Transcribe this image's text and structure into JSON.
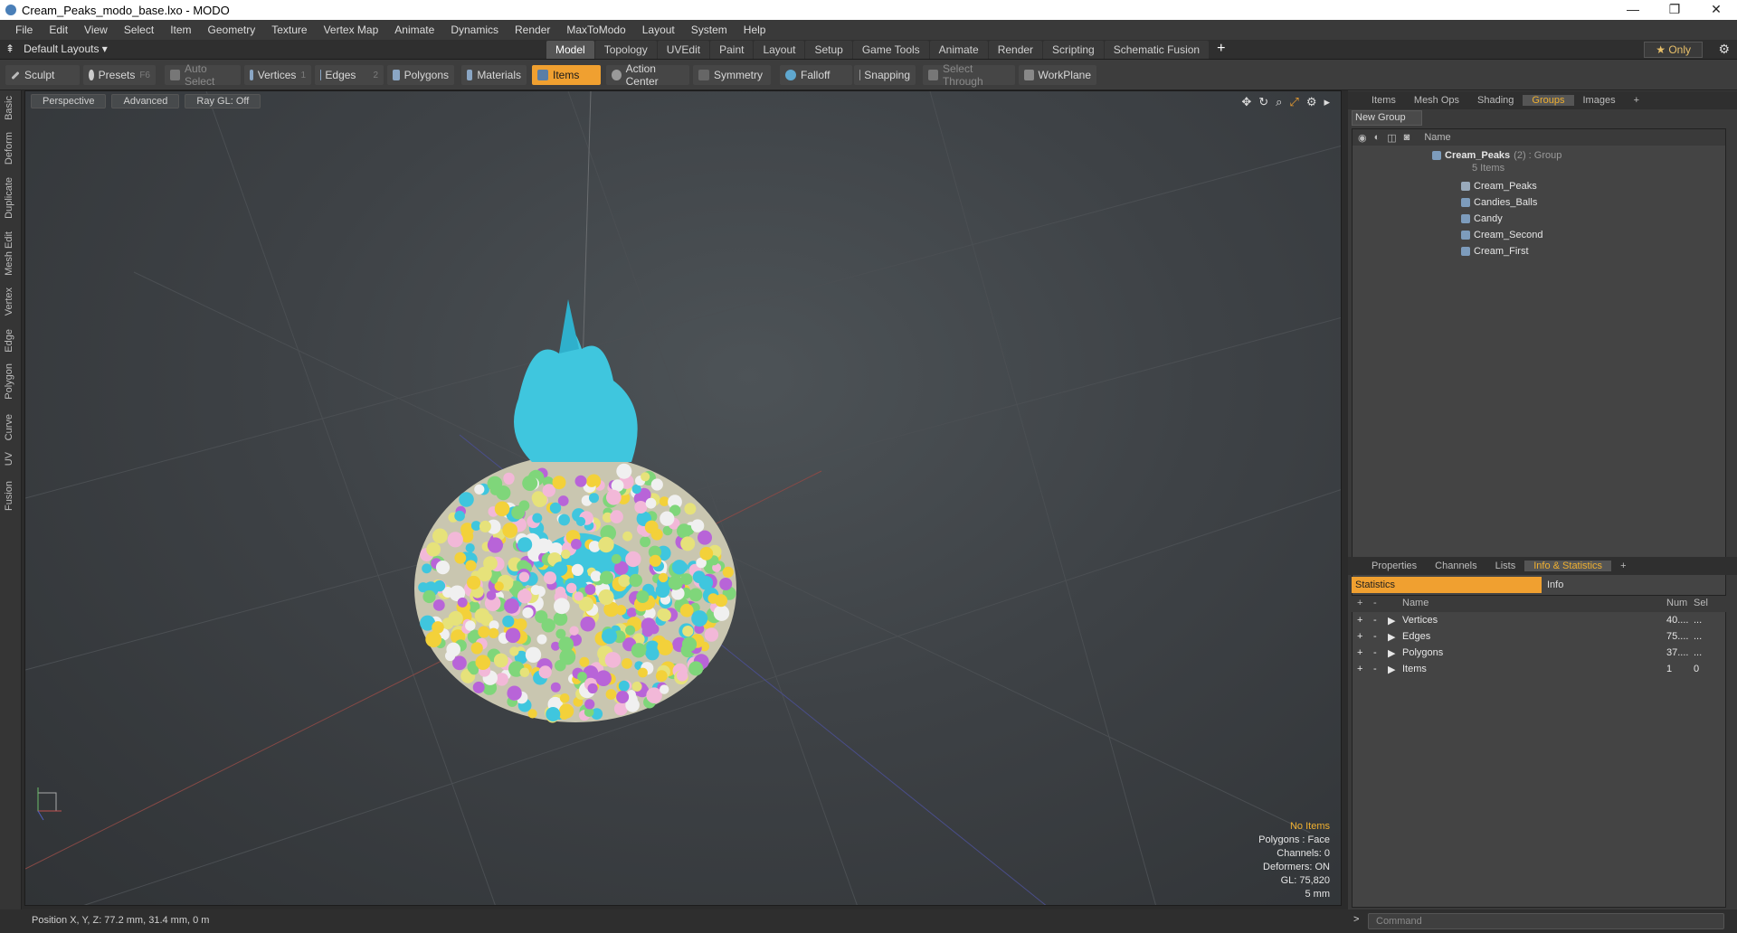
{
  "window": {
    "title": "Cream_Peaks_modo_base.lxo - MODO",
    "controls": [
      "—",
      "❐",
      "✕"
    ]
  },
  "menu": [
    "File",
    "Edit",
    "View",
    "Select",
    "Item",
    "Geometry",
    "Texture",
    "Vertex Map",
    "Animate",
    "Dynamics",
    "Render",
    "MaxToModo",
    "Layout",
    "System",
    "Help"
  ],
  "layouts": {
    "label": "Default Layouts ▾"
  },
  "tabs": [
    "Model",
    "Topology",
    "UVEdit",
    "Paint",
    "Layout",
    "Setup",
    "Game Tools",
    "Animate",
    "Render",
    "Scripting",
    "Schematic Fusion"
  ],
  "active_tab": "Model",
  "only_label": "★  Only",
  "toolbar": {
    "sculpt": "Sculpt",
    "presets": "Presets",
    "presets_key": "F6",
    "auto_select": "Auto Select",
    "vertices": "Vertices",
    "vertices_key": "1",
    "edges": "Edges",
    "edges_key": "2",
    "polygons": "Polygons",
    "materials": "Materials",
    "items": "Items",
    "action_center": "Action Center",
    "symmetry": "Symmetry",
    "falloff": "Falloff",
    "snapping": "Snapping",
    "select_through": "Select Through",
    "workplane": "WorkPlane"
  },
  "left_tabs": [
    "Basic",
    "Deform",
    "Duplicate",
    "Mesh Edit",
    "Vertex",
    "Edge",
    "Polygon",
    "Curve",
    "UV",
    "Fusion"
  ],
  "viewport": {
    "view": "Perspective",
    "shading": "Advanced",
    "raygl": "Ray GL: Off",
    "info": {
      "no_items": "No Items",
      "polygons": "Polygons : Face",
      "channels": "Channels: 0",
      "deformers": "Deformers: ON",
      "gl": "GL: 75,820",
      "scale": "5 mm"
    }
  },
  "status": "Position X, Y, Z:   77.2 mm, 31.4 mm, 0 m",
  "top_panel": {
    "tabs": [
      "Items",
      "Mesh Ops",
      "Shading",
      "Groups",
      "Images"
    ],
    "active": "Groups",
    "new_group": "New Group",
    "name_header": "Name",
    "group": {
      "name": "Cream_Peaks",
      "count": "(2) : Group",
      "items_count": "5 Items"
    },
    "items": [
      "Cream_Peaks",
      "Candies_Balls",
      "Candy",
      "Cream_Second",
      "Cream_First"
    ]
  },
  "bottom_panel": {
    "tabs": [
      "Properties",
      "Channels",
      "Lists",
      "Info & Statistics"
    ],
    "active": "Info & Statistics",
    "statistics": "Statistics",
    "info": "Info",
    "headers": {
      "name": "Name",
      "num": "Num",
      "sel": "Sel"
    },
    "rows": [
      {
        "name": "Vertices",
        "num": "40....",
        "sel": "..."
      },
      {
        "name": "Edges",
        "num": "75....",
        "sel": "..."
      },
      {
        "name": "Polygons",
        "num": "37....",
        "sel": "..."
      },
      {
        "name": "Items",
        "num": "1",
        "sel": "0"
      }
    ]
  },
  "command": {
    "placeholder": "Command"
  }
}
